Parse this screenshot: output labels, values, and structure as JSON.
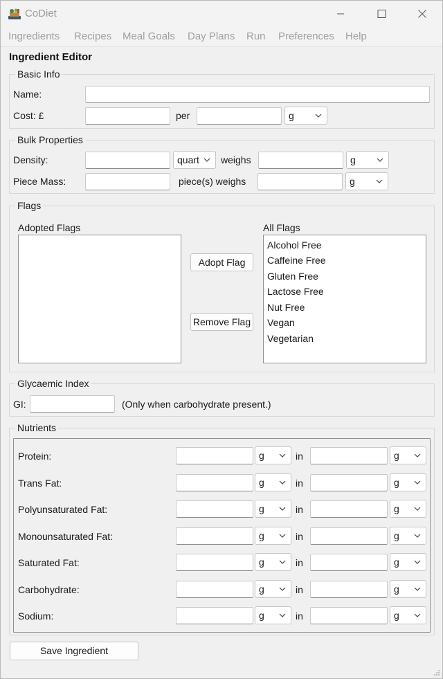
{
  "window": {
    "title": "CoDiet",
    "icon": "app-logo-icon",
    "controls": [
      "minimize-icon",
      "maximize-icon",
      "close-icon"
    ]
  },
  "menu": [
    "Ingredients",
    "Recipes",
    "Meal Goals",
    "Day Plans",
    "Run",
    "Preferences",
    "Help"
  ],
  "editor_title": "Ingredient Editor",
  "basic_info": {
    "title": "Basic Info",
    "name_label": "Name:",
    "name_value": "",
    "cost_label": "Cost: £",
    "cost_value": "",
    "per_label": "per",
    "per_value": "",
    "per_unit": "g"
  },
  "bulk": {
    "title": "Bulk Properties",
    "density_label": "Density:",
    "density_value": "",
    "density_unit": "quart",
    "weighs_label": "weighs",
    "weighs_value": "",
    "weighs_unit": "g",
    "piece_label": "Piece Mass:",
    "piece_value": "",
    "piece_weighs_label": "piece(s) weighs",
    "piece_weighs_value": "",
    "piece_weighs_unit": "g"
  },
  "flags": {
    "title": "Flags",
    "adopted_label": "Adopted Flags",
    "all_label": "All Flags",
    "adopted": [],
    "all": [
      "Alcohol Free",
      "Caffeine Free",
      "Gluten Free",
      "Lactose Free",
      "Nut Free",
      "Vegan",
      "Vegetarian"
    ],
    "adopt_button": "Adopt Flag",
    "remove_button": "Remove Flag"
  },
  "glycaemic": {
    "title": "Glycaemic Index",
    "gi_label": "GI:",
    "gi_value": "",
    "note": "(Only when carbohydrate present.)"
  },
  "nutrients": {
    "title": "Nutrients",
    "in_label": "in",
    "rows": [
      {
        "name": "Protein:",
        "qty": "",
        "qty_unit": "g",
        "per": "",
        "per_unit": "g"
      },
      {
        "name": "Trans Fat:",
        "qty": "",
        "qty_unit": "g",
        "per": "",
        "per_unit": "g"
      },
      {
        "name": "Polyunsaturated Fat:",
        "qty": "",
        "qty_unit": "g",
        "per": "",
        "per_unit": "g"
      },
      {
        "name": "Monounsaturated Fat:",
        "qty": "",
        "qty_unit": "g",
        "per": "",
        "per_unit": "g"
      },
      {
        "name": "Saturated Fat:",
        "qty": "",
        "qty_unit": "g",
        "per": "",
        "per_unit": "g"
      },
      {
        "name": "Carbohydrate:",
        "qty": "",
        "qty_unit": "g",
        "per": "",
        "per_unit": "g"
      },
      {
        "name": "Sodium:",
        "qty": "",
        "qty_unit": "g",
        "per": "",
        "per_unit": "g"
      }
    ]
  },
  "save_button": "Save Ingredient"
}
